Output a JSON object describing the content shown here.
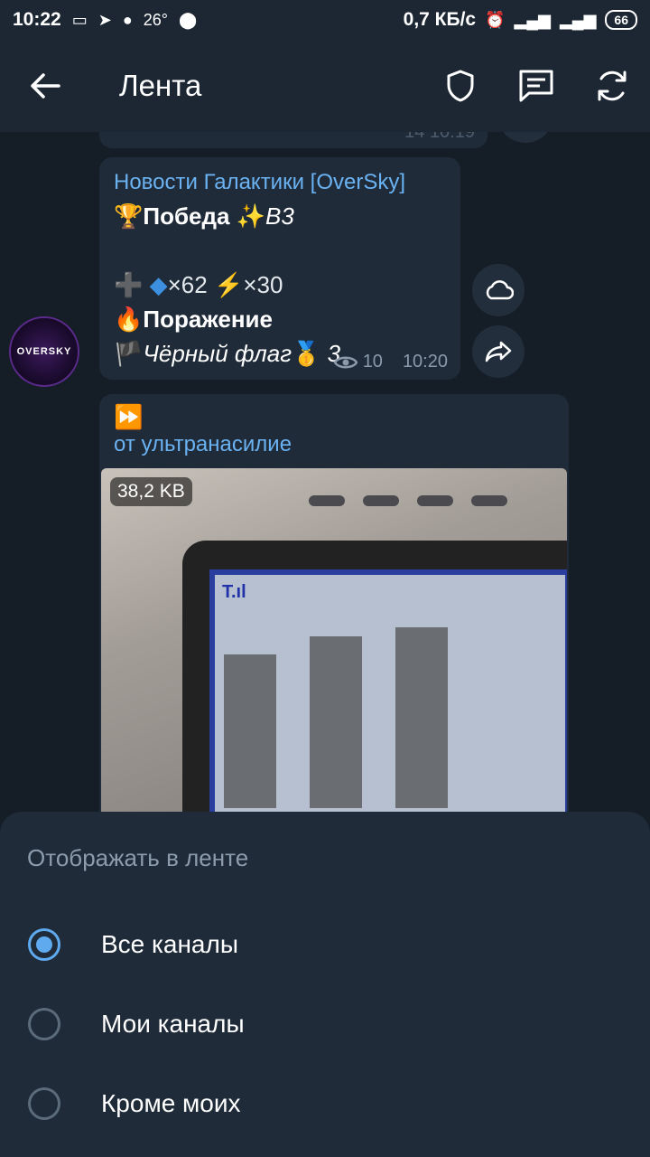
{
  "statusbar": {
    "time": "10:22",
    "temp": "26°",
    "speed": "0,7 КБ/с",
    "battery": "66"
  },
  "appbar": {
    "title": "Лента"
  },
  "feed": {
    "prev_post": {
      "views": "14",
      "time": "10:19"
    },
    "post1": {
      "channel": "Новости Галактики [OverSky]",
      "win_label": "Победа",
      "win_value": "B3",
      "crystals": "×62",
      "energy": "×30",
      "loss_label": "Поражение",
      "flag_label": "Чёрный флаг",
      "flag_value": "3",
      "views": "10",
      "time": "10:20"
    },
    "avatar_text": "OVERSKY",
    "post2": {
      "forward_icon": "⏩",
      "forwarded_from": "от ультранасилие",
      "file_size": "38,2 KB",
      "screen_status": "T.ıl"
    }
  },
  "sheet": {
    "title": "Отображать в ленте",
    "options": [
      {
        "label": "Все каналы",
        "selected": true
      },
      {
        "label": "Мои каналы",
        "selected": false
      },
      {
        "label": "Кроме моих",
        "selected": false
      }
    ]
  },
  "colors": {
    "accent": "#5fa9ef",
    "link": "#6ab2f2",
    "background": "#151d27",
    "bubble": "#1f2b38"
  }
}
